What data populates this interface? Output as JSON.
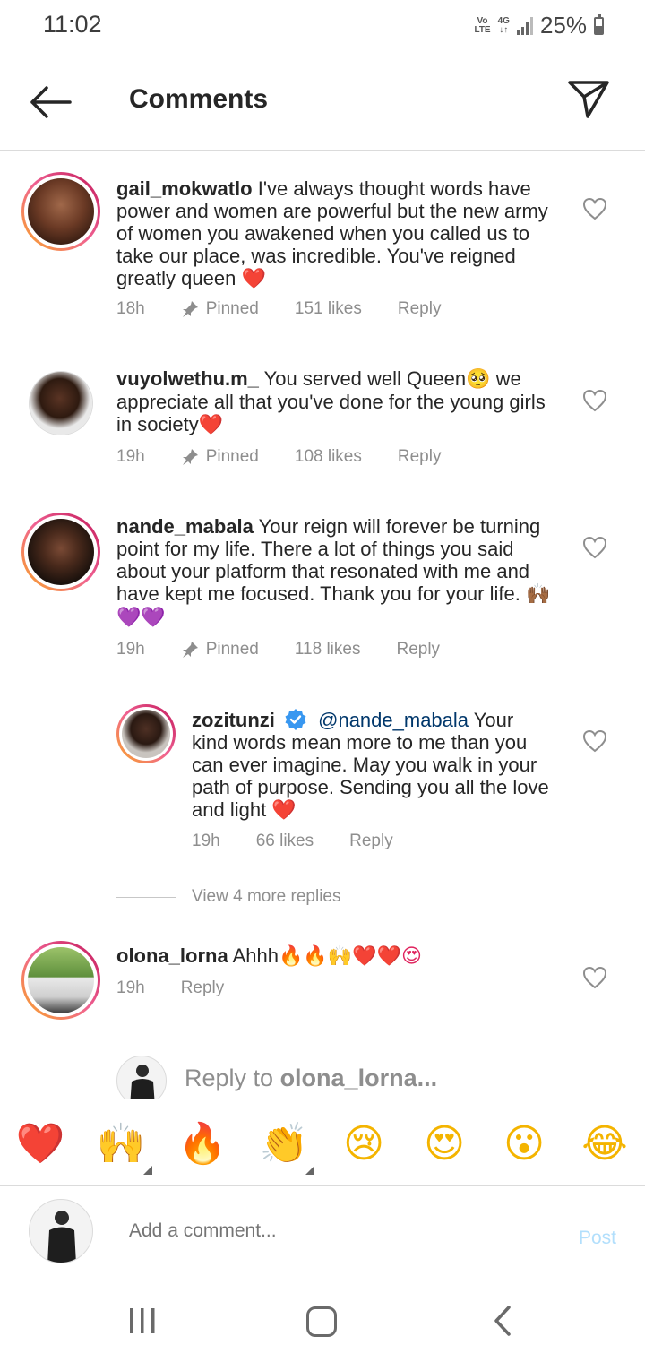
{
  "status_bar": {
    "time": "11:02",
    "net_top": "Vo",
    "net_bottom": "LTE",
    "net_gen": "4G",
    "battery": "25%"
  },
  "header": {
    "title": "Comments"
  },
  "comments": [
    {
      "username": "gail_mokwatlo",
      "text": "I've always thought words have power and women are powerful but the new army of women you awakened when you called us to take our place, was incredible. You've reigned greatly queen",
      "emoji": "❤️",
      "time": "18h",
      "pinned": "Pinned",
      "likes": "151 likes",
      "reply": "Reply"
    },
    {
      "username": "vuyolwethu.m_",
      "text": "You served well Queen",
      "emoji1": "🥺",
      "text2": "we appreciate all that you've done for the young girls in society",
      "emoji2": "❤️",
      "time": "19h",
      "pinned": "Pinned",
      "likes": "108 likes",
      "reply": "Reply"
    },
    {
      "username": "nande_mabala",
      "text": "Your reign will forever be turning point for my life. There a lot of things you said about your platform that resonated with me and have kept me focused. Thank you for your life.",
      "emoji": "🙌🏾 💜💜",
      "time": "19h",
      "pinned": "Pinned",
      "likes": "118 likes",
      "reply": "Reply"
    },
    {
      "username": "zozitunzi",
      "mention": "@nande_mabala",
      "text": "Your kind words mean more to me than you can ever imagine. May you walk in your path of purpose. Sending you all the love and light",
      "emoji": "❤️",
      "time": "19h",
      "likes": "66 likes",
      "reply": "Reply"
    },
    {
      "username": "olona_lorna",
      "text": "Ahhh",
      "emoji": "🔥🔥🙌❤️❤️😍",
      "time": "19h",
      "reply": "Reply"
    }
  ],
  "view_more": "View 4 more replies",
  "reply_bar": {
    "prefix": "Reply to ",
    "target": "olona_lorna..."
  },
  "emoji_bar": [
    "❤️",
    "🙌",
    "🔥",
    "👏",
    "😢",
    "😍",
    "😮",
    "😂"
  ],
  "add_comment": {
    "placeholder": "Add a comment...",
    "post": "Post"
  },
  "colors": {
    "ring_start": "#f9a825",
    "ring_end": "#c2185b",
    "post_disabled": "#b2dffc",
    "mention": "#00376b",
    "verified": "#3897f0"
  }
}
